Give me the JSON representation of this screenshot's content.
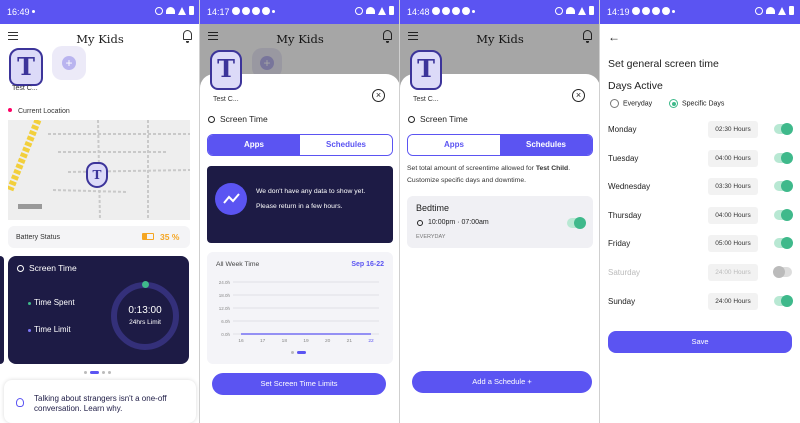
{
  "screen1": {
    "status_time": "16:49",
    "title": "My Kids",
    "kid_initial": "T",
    "kid_name": "Test C...",
    "current_location_label": "Current Location",
    "battery_label": "Battery Status",
    "battery_value": "35 %",
    "screen_time_title": "Screen Time",
    "time_spent_label": "Time Spent",
    "time_limit_label": "Time Limit",
    "time_value": "0:13:00",
    "limit_value": "24hrs Limit",
    "tip_text": "Talking about strangers isn't a one-off conversation. Learn why."
  },
  "screen2": {
    "status_time": "14:17",
    "title": "My Kids",
    "kid_initial": "T",
    "kid_name": "Test C...",
    "close": "×",
    "sheet_title": "Screen Time",
    "tab_apps": "Apps",
    "tab_schedules": "Schedules",
    "no_data_line1": "We don't have any data to show yet.",
    "no_data_line2": "Please return in a few hours.",
    "chart_title": "All Week Time",
    "chart_range": "Sep 16-22",
    "set_limits_button": "Set Screen Time Limits"
  },
  "screen3": {
    "status_time": "14:48",
    "title": "My Kids",
    "kid_initial": "T",
    "kid_name": "Test C...",
    "close": "×",
    "sheet_title": "Screen Time",
    "tab_apps": "Apps",
    "tab_schedules": "Schedules",
    "desc_prefix": "Set total amount of screentime allowed for ",
    "desc_child": "Test Child",
    "desc_suffix": ".",
    "desc_line2": "Customize specific days and downtime.",
    "schedule_name": "Bedtime",
    "schedule_time": "10:00pm · 07:00am",
    "schedule_days": "EVERYDAY",
    "add_schedule_button": "Add a Schedule  +"
  },
  "screen4": {
    "status_time": "14:19",
    "back": "←",
    "heading": "Set general screen time",
    "days_active_label": "Days Active",
    "option_everyday": "Everyday",
    "option_specific": "Specific Days",
    "days": [
      {
        "day": "Monday",
        "hours": "02:30 Hours",
        "enabled": true
      },
      {
        "day": "Tuesday",
        "hours": "04:00 Hours",
        "enabled": true
      },
      {
        "day": "Wednesday",
        "hours": "03:30 Hours",
        "enabled": true
      },
      {
        "day": "Thursday",
        "hours": "04:00 Hours",
        "enabled": true
      },
      {
        "day": "Friday",
        "hours": "05:00 Hours",
        "enabled": true
      },
      {
        "day": "Saturday",
        "hours": "24:00 Hours",
        "enabled": false
      },
      {
        "day": "Sunday",
        "hours": "24:00 Hours",
        "enabled": true
      }
    ],
    "save_button": "Save"
  },
  "chart_data": {
    "type": "line",
    "title": "All Week Time",
    "categories": [
      "16",
      "17",
      "18",
      "19",
      "20",
      "21",
      "22"
    ],
    "y_ticks": [
      "24.0h",
      "18.0h",
      "12.0h",
      "6.0h",
      "0.0h"
    ],
    "ylim": [
      0,
      24
    ],
    "series": [
      {
        "values": [
          0,
          0,
          0,
          0,
          0,
          0,
          0
        ]
      }
    ],
    "grid": true
  },
  "colors": {
    "accent": "#5b54f2",
    "dark_card": "#1d1b45",
    "toggle_on": "#3fb98b",
    "battery": "#f5a623"
  }
}
